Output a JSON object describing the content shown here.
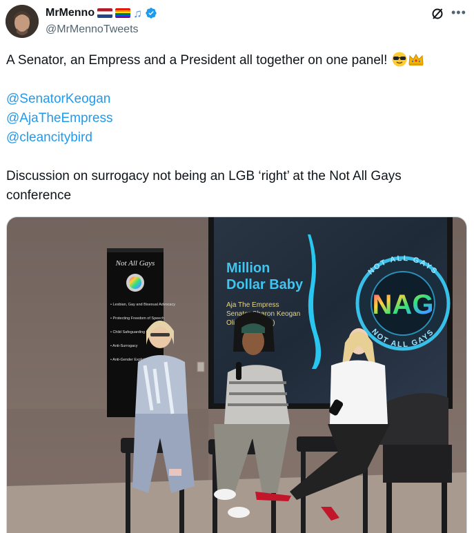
{
  "author": {
    "display_name": "MrMenno",
    "handle": "@MrMennoTweets",
    "flags": [
      "netherlands-flag",
      "pride-flag"
    ],
    "badge_icon": "verified-icon",
    "note_glyph": "♫"
  },
  "tweet": {
    "line1": "A Senator, an Empress and a President all together on one panel!",
    "line1_emojis": [
      "sunglasses-emoji",
      "crown-emoji"
    ],
    "mentions": [
      "@SenatorKeogan",
      "@AjaTheEmpress",
      "@cleancitybird"
    ],
    "line2": "Discussion on surrogacy not being an LGB ‘right’ at the Not All Gays conference"
  },
  "photo": {
    "banner": {
      "title": "Not All Gays",
      "items": [
        "• Lesbian, Gay and Bisexual Advocacy",
        "• Protecting Freedom of Speech",
        "• Child Safeguarding",
        "• Anti-Surrogacy",
        "• Anti-Gender Exploitation"
      ]
    },
    "screen": {
      "title_line1": "Million",
      "title_line2": "Dollar Baby",
      "speaker1": "Aja The Empress",
      "speaker2": "Senator Sharon Keogan",
      "speaker3": "Olivia (Podcast)",
      "logo_top": "NOT ALL GAYS",
      "logo_mid": "NAG",
      "logo_bottom": "NOT ALL GAYS"
    }
  },
  "colors": {
    "link": "#1d9bf0",
    "muted": "#536471",
    "verified": "#1d9bf0"
  }
}
